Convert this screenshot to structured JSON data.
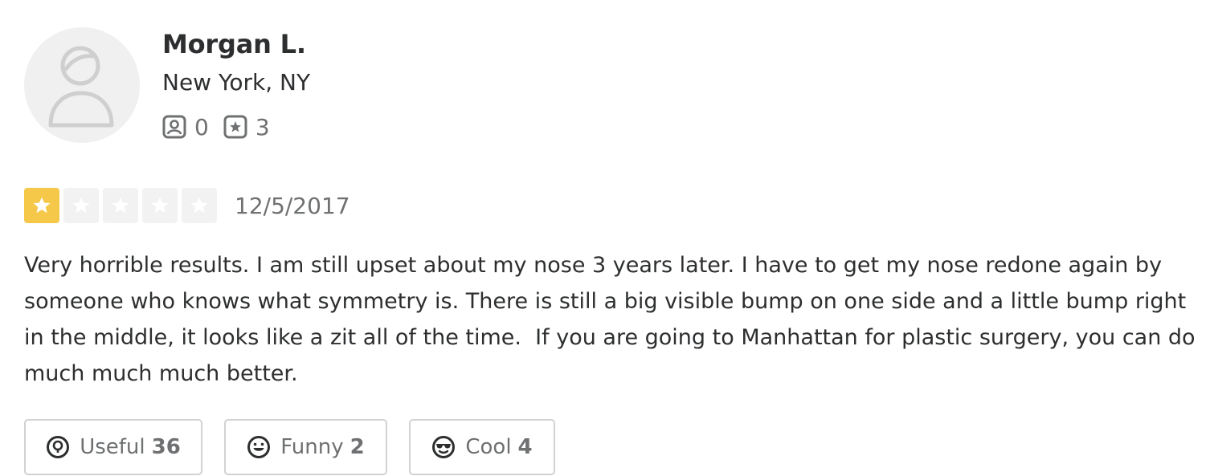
{
  "reviewer": {
    "name": "Morgan L.",
    "location": "New York, NY",
    "friends_count": "0",
    "reviews_count": "3",
    "avatar_icon": "default-user-avatar"
  },
  "review": {
    "rating": 1,
    "rating_max": 5,
    "date": "12/5/2017",
    "text": "Very horrible results. I am still upset about my nose 3 years later. I have to get my nose redone again by someone who knows what symmetry is. There is still a big visible bump on one side and a little bump right in the middle, it looks like a zit all of the time.  If you are going to Manhattan for plastic surgery, you can do much much much better."
  },
  "votes": {
    "useful": {
      "label": "Useful",
      "count": "36",
      "icon": "lightbulb-icon"
    },
    "funny": {
      "label": "Funny",
      "count": "2",
      "icon": "smiley-icon"
    },
    "cool": {
      "label": "Cool",
      "count": "4",
      "icon": "sunglasses-face-icon"
    }
  },
  "colors": {
    "star_active": "#f5c84a",
    "star_inactive": "#f2f2f2",
    "text_primary": "#2d2e2f",
    "text_secondary": "#6e7072",
    "button_border": "#d2d2d2"
  }
}
